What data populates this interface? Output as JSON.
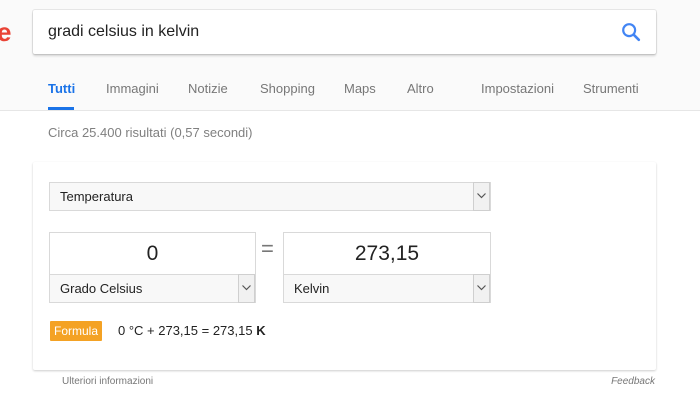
{
  "logo": {
    "fragment": "e",
    "color": "#e94335"
  },
  "search": {
    "query": "gradi celsius in kelvin",
    "icon": "search-icon"
  },
  "tabs": [
    {
      "label": "Tutti",
      "active": true
    },
    {
      "label": "Immagini"
    },
    {
      "label": "Notizie"
    },
    {
      "label": "Shopping"
    },
    {
      "label": "Maps"
    },
    {
      "label": "Altro"
    },
    {
      "label": "Impostazioni"
    },
    {
      "label": "Strumenti"
    }
  ],
  "result_stats": "Circa 25.400 risultati (0,57 secondi)",
  "converter": {
    "category": "Temperatura",
    "from": {
      "value": "0",
      "unit": "Grado Celsius"
    },
    "equals": "=",
    "to": {
      "value": "273,15",
      "unit": "Kelvin"
    },
    "formula_label": "Formula",
    "formula": "0 °C + 273,15 = 273,15 ",
    "formula_unit": "K",
    "badge_color": "#f4a224"
  },
  "footer": {
    "more_info": "Ulteriori informazioni",
    "feedback": "Feedback"
  },
  "colors": {
    "accent": "#1a73e8",
    "search_icon": "#4285f4"
  }
}
